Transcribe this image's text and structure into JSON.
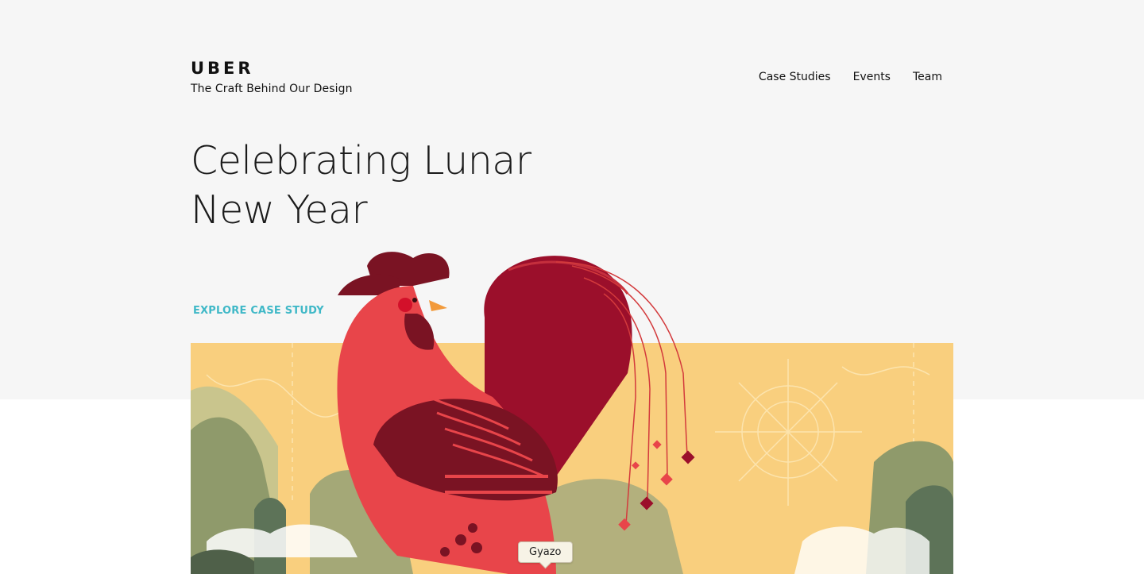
{
  "header": {
    "logo": "UBER",
    "tagline": "The Craft Behind Our Design"
  },
  "nav": {
    "items": [
      "Case Studies",
      "Events",
      "Team"
    ]
  },
  "hero": {
    "title_line1": "Celebrating Lunar",
    "title_line2": "New Year",
    "cta": "EXPLORE CASE STUDY",
    "illustration": "rooster-illustration"
  },
  "tooltip": {
    "text": "Gyazo"
  },
  "colors": {
    "page_bg": "#f6f6f6",
    "accent": "#3fb8c7",
    "hero_bg": "#f9cf7e",
    "rooster_red": "#e8454a",
    "rooster_dark": "#9b0f2b"
  }
}
